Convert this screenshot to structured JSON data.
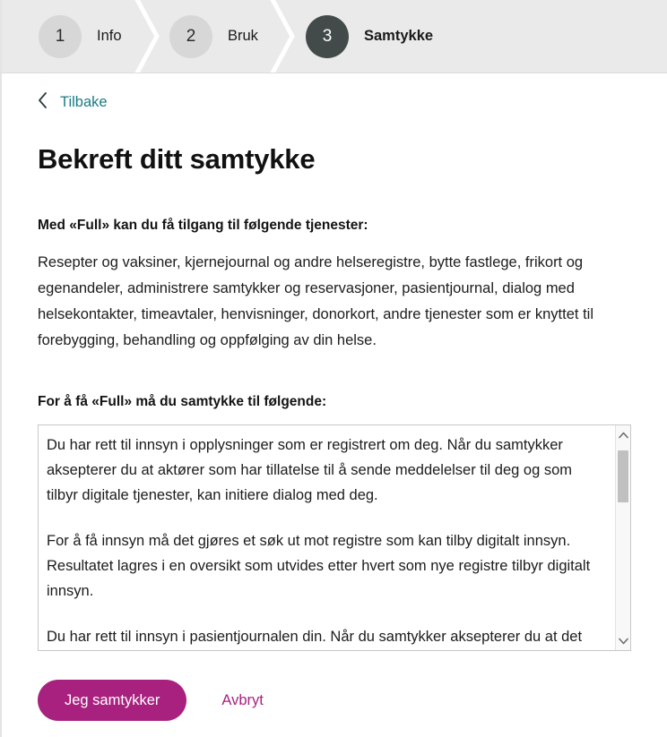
{
  "stepper": {
    "steps": [
      {
        "number": "1",
        "label": "Info",
        "state": "inactive"
      },
      {
        "number": "2",
        "label": "Bruk",
        "state": "inactive"
      },
      {
        "number": "3",
        "label": "Samtykke",
        "state": "active"
      }
    ],
    "separator_icon": "chevron-right-icon",
    "background_color": "#eaeaea",
    "active_circle_color": "#434a4a",
    "inactive_circle_color": "#d7d7d7"
  },
  "back": {
    "icon": "chevron-left-icon",
    "label": "Tilbake",
    "link_color": "#1a7b84"
  },
  "main": {
    "title": "Bekreft ditt samtykke",
    "services_lead": "Med «Full» kan du få tilgang til følgende tjenester:",
    "services_paragraph": "Resepter og vaksiner, kjernejournal og andre helseregistre, bytte fastlege, frikort og egenandeler, administrere samtykker og reservasjoner, pasientjournal, dialog med helsekontakter, timeavtaler, henvisninger, donorkort, andre tjenester som er knyttet til forebygging, behandling og oppfølging av din helse.",
    "consent_lead": "For å få «Full» må du samtykke til følgende:",
    "consent_paragraphs": [
      "Du har rett til innsyn i opplysninger som er registrert om deg. Når du samtykker aksepterer du at aktører som har tillatelse til å sende meddelelser til deg og som tilbyr digitale tjenester, kan initiere dialog med deg.",
      "For å få innsyn må det gjøres et søk ut mot registre som kan tilby digitalt innsyn. Resultatet lagres i en oversikt som utvides etter hvert som nye registre tilbyr digitalt innsyn.",
      "Du har rett til innsyn i pasientjournalen din. Når du samtykker aksepterer du at det kan gjøres et søk mot sykehus som kan ha opplysninger om deg. Du vil få"
    ]
  },
  "scrollbar": {
    "up_icon": "chevron-up-icon",
    "down_icon": "chevron-down-icon",
    "thumb_position": "near-top"
  },
  "actions": {
    "consent_label": "Jeg samtykker",
    "cancel_label": "Avbryt",
    "accent_color": "#a8217f"
  }
}
